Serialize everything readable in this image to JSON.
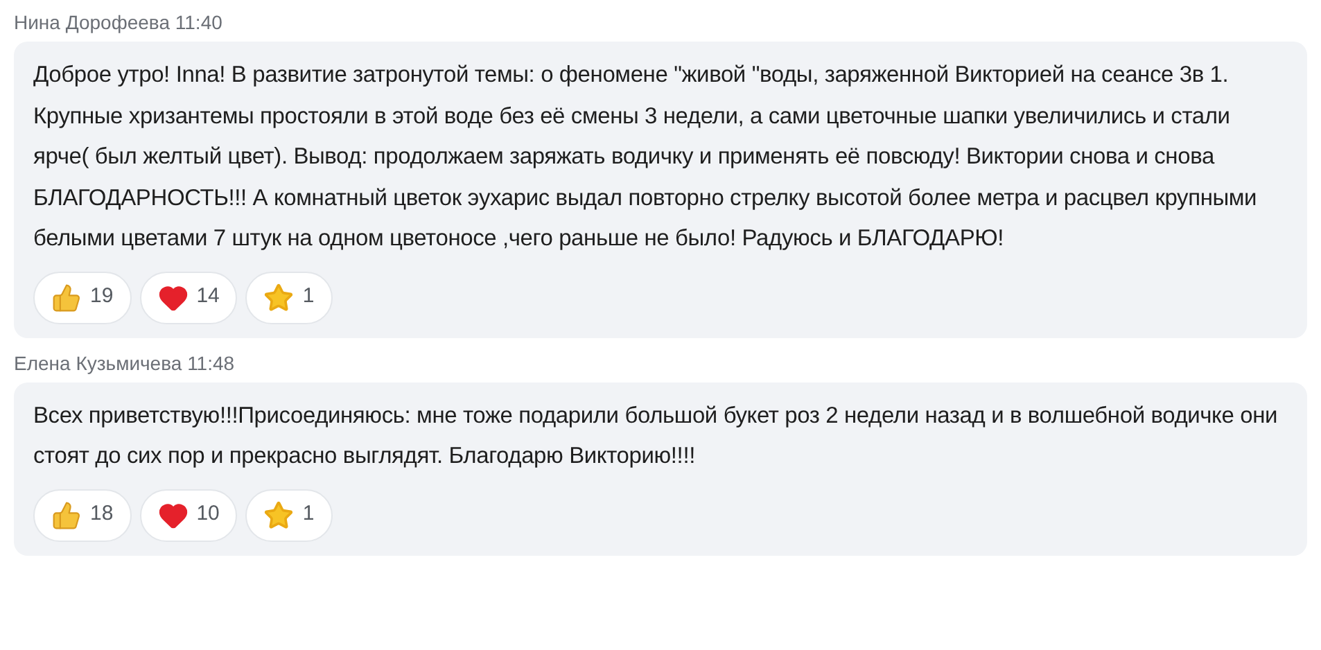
{
  "messages": [
    {
      "author": "Нина Дорофеева",
      "time": "11:40",
      "text": "Доброе утро! Inna! В развитие затронутой темы: о феномене \"живой \"воды, заряженной Викторией на сеансе 3в 1. Крупные хризантемы простояли в этой воде без её смены 3 недели, а сами цветочные шапки увеличились и стали ярче( был желтый цвет). Вывод: продолжаем заряжать водичку и применять её повсюду! Виктории снова и снова БЛАГОДАРНОСТЬ!!! А комнатный цветок эухарис выдал повторно стрелку высотой более метра и расцвел крупными белыми цветами 7 штук на одном цветоносе ,чего раньше не было! Радуюсь и БЛАГОДАРЮ!",
      "reactions": [
        {
          "kind": "like",
          "count": "19"
        },
        {
          "kind": "heart",
          "count": "14"
        },
        {
          "kind": "star",
          "count": "1"
        }
      ]
    },
    {
      "author": "Елена Кузьмичева",
      "time": "11:48",
      "text": "Всех приветствую!!!Присоединяюсь: мне тоже подарили большой букет роз 2 недели назад и в волшебной водичке они стоят до сих пор и прекрасно выглядят. Благодарю Викторию!!!!",
      "reactions": [
        {
          "kind": "like",
          "count": "18"
        },
        {
          "kind": "heart",
          "count": "10"
        },
        {
          "kind": "star",
          "count": "1"
        }
      ]
    }
  ]
}
